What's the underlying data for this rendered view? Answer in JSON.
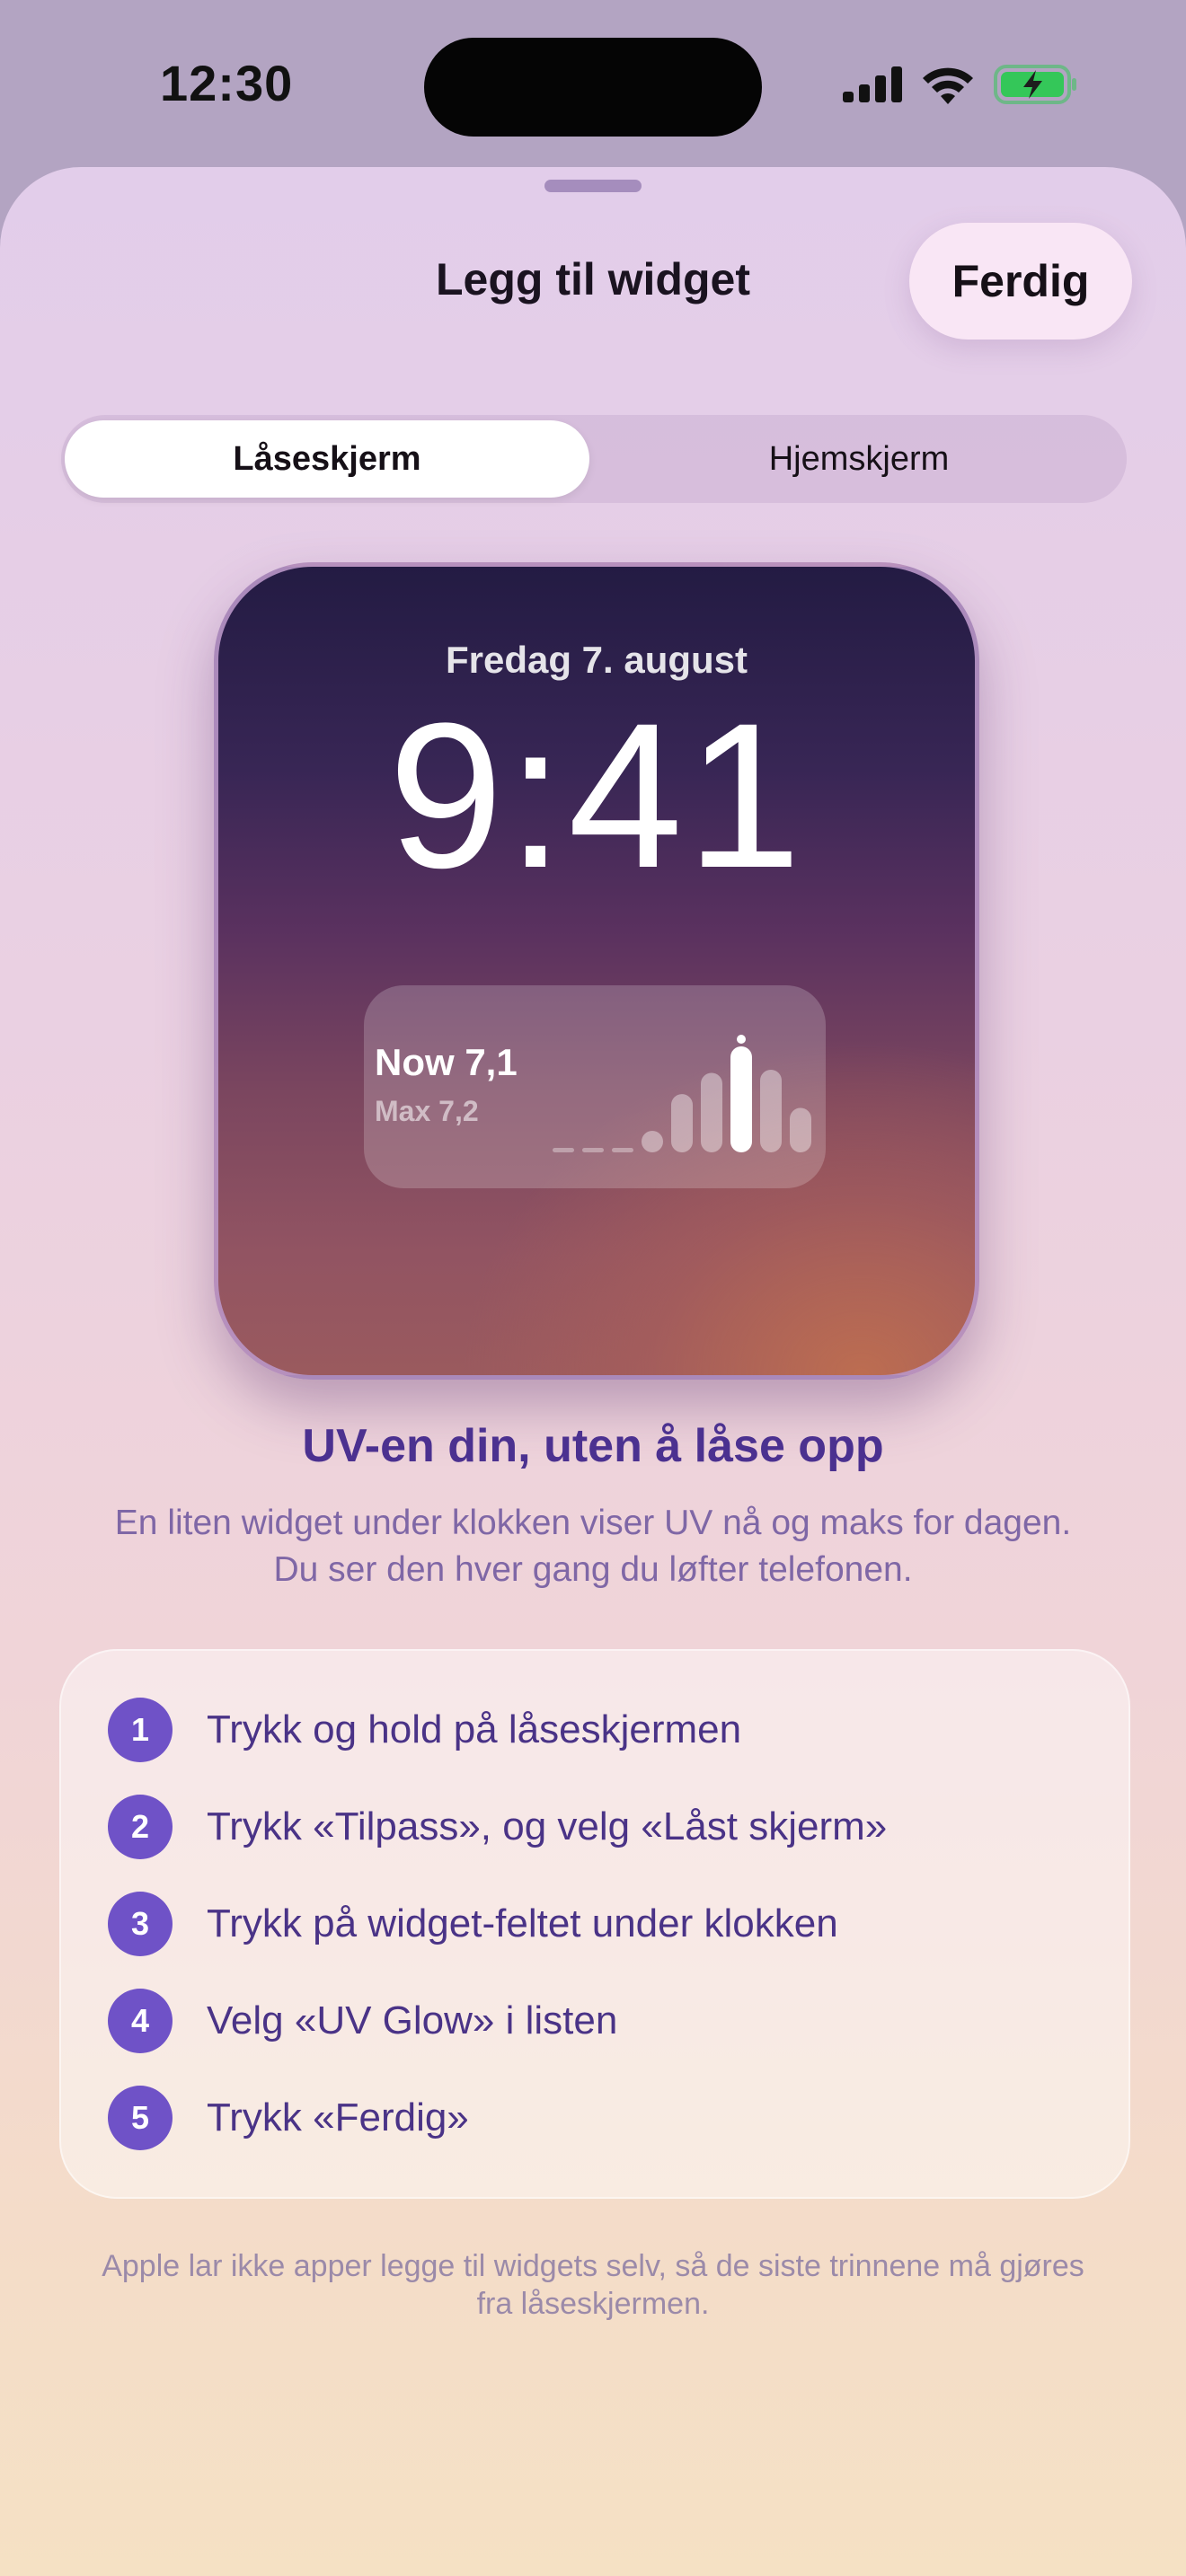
{
  "status_bar": {
    "time": "12:30",
    "icons": [
      "cellular-signal-icon",
      "wifi-icon",
      "battery-charging-icon"
    ],
    "battery_color": "#34c759"
  },
  "sheet": {
    "title": "Legg til widget",
    "done_label": "Ferdig"
  },
  "segmented": {
    "options": [
      "Låseskjerm",
      "Hjemskjerm"
    ],
    "selected": "Låseskjerm"
  },
  "lock_preview": {
    "date": "Fredag 7. august",
    "time": "9:41",
    "widget": {
      "now": "Now 7,1",
      "max": "Max 7,2",
      "bar_levels": [
        0,
        0,
        0,
        0.12,
        0.55,
        0.75,
        1.0,
        0.78,
        0.42
      ],
      "highlight_index": 6
    }
  },
  "info": {
    "headline": "UV-en din, uten å låse opp",
    "description": "En liten widget under klokken viser UV nå og maks for dagen. Du ser den hver gang du løfter telefonen."
  },
  "steps": [
    {
      "num": "1",
      "text": "Trykk og hold på låseskjermen"
    },
    {
      "num": "2",
      "text": "Trykk «Tilpass», og velg «Låst skjerm»"
    },
    {
      "num": "3",
      "text": "Trykk på widget-feltet under klokken"
    },
    {
      "num": "4",
      "text": "Velg «UV Glow» i listen"
    },
    {
      "num": "5",
      "text": "Trykk «Ferdig»"
    }
  ],
  "footnote": "Apple lar ikke apper legge til widgets selv, så de siste trinnene må gjøres fra låseskjermen.",
  "colors": {
    "accent": "#6f52c7",
    "headline": "#4b3190",
    "step_text": "#4a3387"
  }
}
